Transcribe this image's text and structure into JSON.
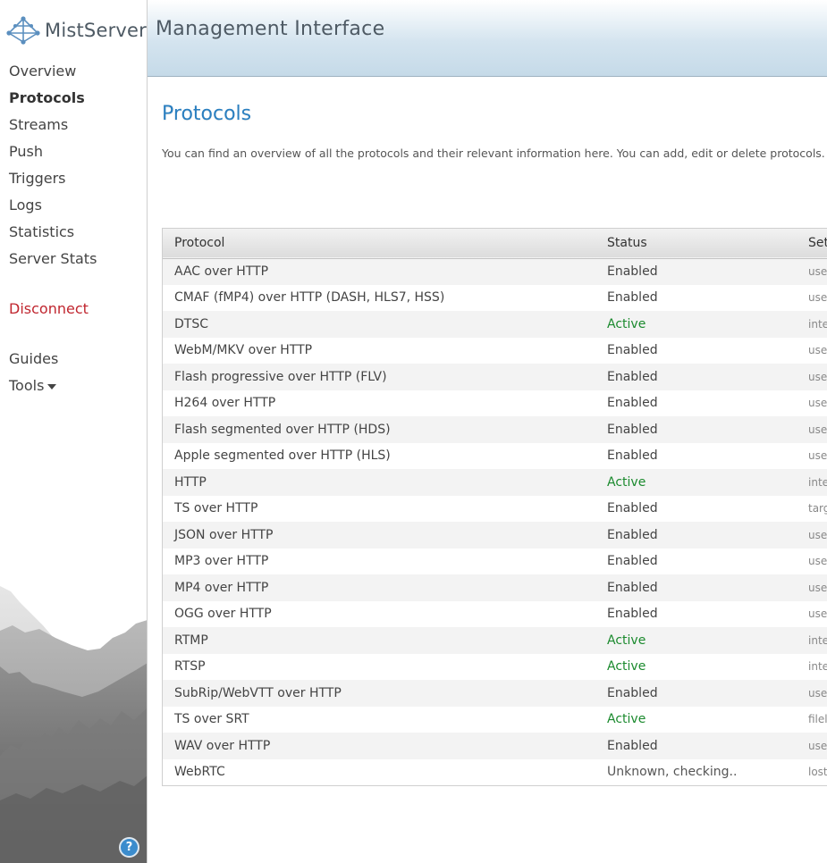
{
  "app": {
    "logo_text": "MistServer",
    "header_title": "Management Interface"
  },
  "sidebar": {
    "items": [
      {
        "label": "Overview"
      },
      {
        "label": "Protocols"
      },
      {
        "label": "Streams"
      },
      {
        "label": "Push"
      },
      {
        "label": "Triggers"
      },
      {
        "label": "Logs"
      },
      {
        "label": "Statistics"
      },
      {
        "label": "Server Stats"
      }
    ],
    "disconnect_label": "Disconnect",
    "guides_label": "Guides",
    "tools_label": "Tools",
    "help_label": "?"
  },
  "main": {
    "title": "Protocols",
    "description": "You can find an overview of all the protocols and their relevant information here. You can add, edit or delete protocols."
  },
  "table": {
    "headers": [
      "Protocol",
      "Status",
      "Set"
    ],
    "rows": [
      {
        "protocol": "AAC over HTTP",
        "status": "Enabled",
        "status_type": "enabled",
        "settings": "user"
      },
      {
        "protocol": "CMAF (fMP4) over HTTP (DASH, HLS7, HSS)",
        "status": "Enabled",
        "status_type": "enabled",
        "settings": "user"
      },
      {
        "protocol": "DTSC",
        "status": "Active",
        "status_type": "active",
        "settings": "inte"
      },
      {
        "protocol": "WebM/MKV over HTTP",
        "status": "Enabled",
        "status_type": "enabled",
        "settings": "user"
      },
      {
        "protocol": "Flash progressive over HTTP (FLV)",
        "status": "Enabled",
        "status_type": "enabled",
        "settings": "user"
      },
      {
        "protocol": "H264 over HTTP",
        "status": "Enabled",
        "status_type": "enabled",
        "settings": "user"
      },
      {
        "protocol": "Flash segmented over HTTP (HDS)",
        "status": "Enabled",
        "status_type": "enabled",
        "settings": "user"
      },
      {
        "protocol": "Apple segmented over HTTP (HLS)",
        "status": "Enabled",
        "status_type": "enabled",
        "settings": "user"
      },
      {
        "protocol": "HTTP",
        "status": "Active",
        "status_type": "active",
        "settings": "inte"
      },
      {
        "protocol": "TS over HTTP",
        "status": "Enabled",
        "status_type": "enabled",
        "settings": "targ"
      },
      {
        "protocol": "JSON over HTTP",
        "status": "Enabled",
        "status_type": "enabled",
        "settings": "user"
      },
      {
        "protocol": "MP3 over HTTP",
        "status": "Enabled",
        "status_type": "enabled",
        "settings": "user"
      },
      {
        "protocol": "MP4 over HTTP",
        "status": "Enabled",
        "status_type": "enabled",
        "settings": "user"
      },
      {
        "protocol": "OGG over HTTP",
        "status": "Enabled",
        "status_type": "enabled",
        "settings": "user"
      },
      {
        "protocol": "RTMP",
        "status": "Active",
        "status_type": "active",
        "settings": "inte"
      },
      {
        "protocol": "RTSP",
        "status": "Active",
        "status_type": "active",
        "settings": "inte"
      },
      {
        "protocol": "SubRip/WebVTT over HTTP",
        "status": "Enabled",
        "status_type": "enabled",
        "settings": "user"
      },
      {
        "protocol": "TS over SRT",
        "status": "Active",
        "status_type": "active",
        "settings": "filel"
      },
      {
        "protocol": "WAV over HTTP",
        "status": "Enabled",
        "status_type": "enabled",
        "settings": "user"
      },
      {
        "protocol": "WebRTC",
        "status": "Unknown, checking..",
        "status_type": "unknown",
        "settings": "lost"
      }
    ]
  },
  "colors": {
    "active": "#1b8a2e",
    "title_blue": "#2a7fc0",
    "disconnect_red": "#c0262f"
  }
}
